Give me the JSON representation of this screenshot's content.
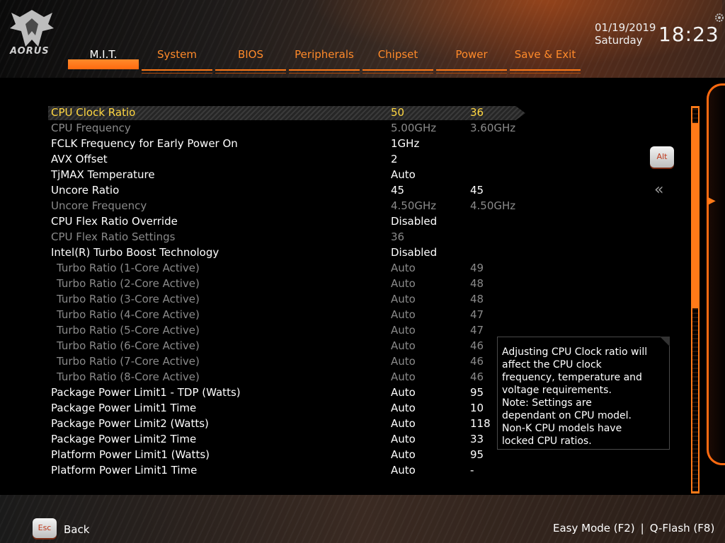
{
  "brand": {
    "logo_text": "AORUS"
  },
  "tabs": [
    {
      "label": "M.I.T.",
      "active": true
    },
    {
      "label": "System",
      "active": false
    },
    {
      "label": "BIOS",
      "active": false
    },
    {
      "label": "Peripherals",
      "active": false
    },
    {
      "label": "Chipset",
      "active": false
    },
    {
      "label": "Power",
      "active": false
    },
    {
      "label": "Save & Exit",
      "active": false
    }
  ],
  "datetime": {
    "date": "01/19/2019",
    "weekday": "Saturday",
    "time": "18:23"
  },
  "settings": [
    {
      "name": "CPU Clock Ratio",
      "value": "50",
      "current": "36",
      "state": "selected"
    },
    {
      "name": "CPU Frequency",
      "value": "5.00GHz",
      "current": "3.60GHz",
      "state": "dim"
    },
    {
      "name": "FCLK Frequency for Early Power On",
      "value": "1GHz",
      "current": "",
      "state": "normal"
    },
    {
      "name": "AVX Offset",
      "value": "2",
      "current": "",
      "state": "normal"
    },
    {
      "name": "TjMAX Temperature",
      "value": "Auto",
      "current": "",
      "state": "normal"
    },
    {
      "name": "Uncore Ratio",
      "value": "45",
      "current": "45",
      "state": "normal"
    },
    {
      "name": "Uncore Frequency",
      "value": "4.50GHz",
      "current": "4.50GHz",
      "state": "dim"
    },
    {
      "name": "CPU Flex Ratio Override",
      "value": "Disabled",
      "current": "",
      "state": "normal"
    },
    {
      "name": "CPU Flex Ratio Settings",
      "value": "36",
      "current": "",
      "state": "dim"
    },
    {
      "name": "Intel(R) Turbo Boost Technology",
      "value": "Disabled",
      "current": "",
      "state": "normal"
    },
    {
      "name": "Turbo Ratio (1-Core Active)",
      "value": "Auto",
      "current": "49",
      "state": "dim-indent"
    },
    {
      "name": "Turbo Ratio (2-Core Active)",
      "value": "Auto",
      "current": "48",
      "state": "dim-indent"
    },
    {
      "name": "Turbo Ratio (3-Core Active)",
      "value": "Auto",
      "current": "48",
      "state": "dim-indent"
    },
    {
      "name": "Turbo Ratio (4-Core Active)",
      "value": "Auto",
      "current": "47",
      "state": "dim-indent"
    },
    {
      "name": "Turbo Ratio (5-Core Active)",
      "value": "Auto",
      "current": "47",
      "state": "dim-indent"
    },
    {
      "name": "Turbo Ratio (6-Core Active)",
      "value": "Auto",
      "current": "46",
      "state": "dim-indent"
    },
    {
      "name": "Turbo Ratio (7-Core Active)",
      "value": "Auto",
      "current": "46",
      "state": "dim-indent"
    },
    {
      "name": "Turbo Ratio (8-Core Active)",
      "value": "Auto",
      "current": "46",
      "state": "dim-indent"
    },
    {
      "name": "Package Power Limit1 - TDP (Watts)",
      "value": "Auto",
      "current": "95",
      "state": "normal"
    },
    {
      "name": "Package Power Limit1 Time",
      "value": "Auto",
      "current": "10",
      "state": "normal"
    },
    {
      "name": "Package Power Limit2 (Watts)",
      "value": "Auto",
      "current": "118",
      "state": "normal"
    },
    {
      "name": "Package Power Limit2 Time",
      "value": "Auto",
      "current": "33",
      "state": "normal"
    },
    {
      "name": "Platform Power Limit1 (Watts)",
      "value": "Auto",
      "current": "95",
      "state": "normal"
    },
    {
      "name": "Platform Power Limit1 Time",
      "value": "Auto",
      "current": "-",
      "state": "normal"
    }
  ],
  "help": {
    "lines": [
      "Adjusting CPU Clock ratio will",
      "affect the CPU clock",
      "frequency, temperature and",
      "voltage requirements.",
      "Note: Settings are",
      "dependant  on  CPU model.",
      "Non-K CPU models have",
      "locked CPU ratios."
    ]
  },
  "keys": {
    "alt": "Alt",
    "esc": "Esc"
  },
  "footer": {
    "back": "Back",
    "easy_mode": "Easy Mode (F2)",
    "separator": "|",
    "qflash": "Q-Flash (F8)"
  },
  "icons": {
    "logo": "aorus-eagle-icon",
    "settings": "gear-icon",
    "collapse": "double-chevron-left-icon",
    "panel": "chevron-right-icon"
  },
  "colors": {
    "accent": "#ff7a18",
    "selected_text": "#ffd640",
    "dim_text": "#8a8a8a"
  }
}
